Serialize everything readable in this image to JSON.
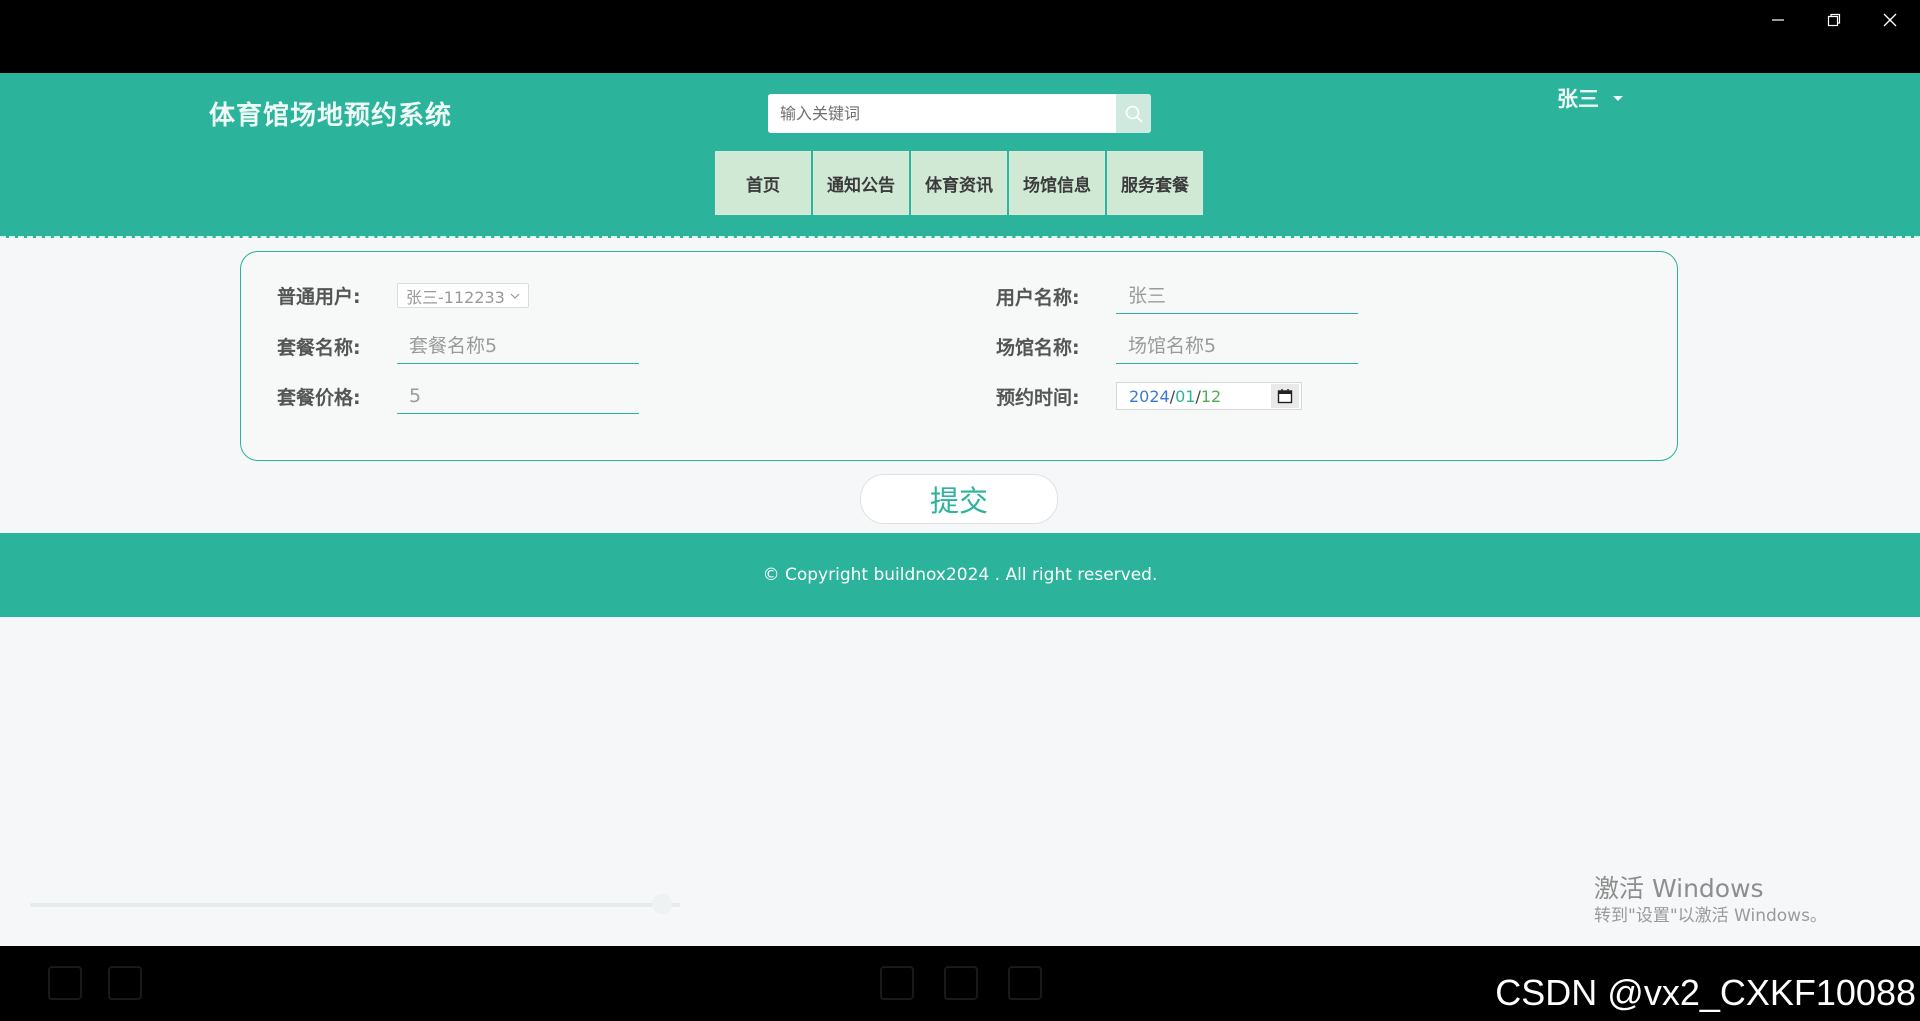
{
  "window": {
    "minimize_icon": "minimize-icon",
    "restore_icon": "restore-icon",
    "close_icon": "close-icon"
  },
  "header": {
    "site_title": "体育馆场地预约系统",
    "search": {
      "placeholder": "输入关键词",
      "value": "",
      "icon": "search-icon"
    },
    "user": {
      "name": "张三"
    },
    "nav": [
      "首页",
      "通知公告",
      "体育资讯",
      "场馆信息",
      "服务套餐"
    ]
  },
  "form": {
    "normal_user": {
      "label": "普通用户:",
      "value": "张三-112233"
    },
    "user_name": {
      "label": "用户名称:",
      "placeholder": "张三"
    },
    "package_name": {
      "label": "套餐名称:",
      "placeholder": "套餐名称5"
    },
    "venue_name": {
      "label": "场馆名称:",
      "placeholder": "场馆名称5"
    },
    "package_price": {
      "label": "套餐价格:",
      "placeholder": "5"
    },
    "booking_time": {
      "label": "预约时间:",
      "year": "2024",
      "month": "01",
      "day": "12",
      "sep": "/"
    }
  },
  "submit_label": "提交",
  "footer": {
    "copyright": "© Copyright buildnox2024 . All right reserved."
  },
  "watermark": {
    "line1": "激活 Windows",
    "line2": "转到\"设置\"以激活 Windows。"
  },
  "overlay": {
    "csdn": "CSDN @vx2_CXKF10088"
  },
  "colors": {
    "brand": "#2bb39b",
    "nav_bg": "#cfe9d5",
    "date_year": "#3a7bd5",
    "date_month": "#2bb39b",
    "date_day": "#4caf50"
  }
}
